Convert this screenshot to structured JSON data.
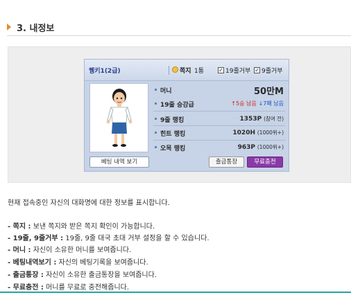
{
  "section": {
    "number_title": "3. 내정보"
  },
  "profile": {
    "nickname": "퀭키1(2급)",
    "note_label": "쪽지",
    "note_count": "1통",
    "check_19": "19줄거부",
    "check_9": "9줄거부",
    "checks_state": {
      "check_19": true,
      "check_9": true
    }
  },
  "stats": {
    "money": {
      "label": "머니",
      "value": "50만M"
    },
    "rank19": {
      "label": "19줄 승강급",
      "up": "↑5승 남음",
      "down": "↓7패 남음"
    },
    "rank9": {
      "label": "9줄 랭킹",
      "value": "1353P",
      "note": "(참여 전)"
    },
    "hint": {
      "label": "힌트 랭킹",
      "value": "1020H",
      "note": "(1000위+)"
    },
    "omok": {
      "label": "오목 랭킹",
      "value": "963P",
      "note": "(1000위+)"
    }
  },
  "buttons": {
    "bet_history": "베팅 내역 보기",
    "bank": "출금통장",
    "charge": "무료충전"
  },
  "description": {
    "intro": "현재 접속중인 자신의 대화명에 대한 정보를 표시합니다.",
    "items": [
      {
        "term": "- 쪽지 :",
        "text": " 보낸 쪽지와 받은 쪽지 확인이 가능합니다."
      },
      {
        "term": "- 19줄, 9줄거부 :",
        "text": " 19줄, 9줄 대국 초대 거부 설정을 할 수 있습니다."
      },
      {
        "term": "- 머니 :",
        "text": " 자신이 소유한 머니를 보여줍니다."
      },
      {
        "term": "- 베팅내역보기 :",
        "text": " 자신의 베팅기록을 보여줍니다."
      },
      {
        "term": "- 출금통장 :",
        "text": " 자신이 소유한 출금통장을 보여줍니다."
      },
      {
        "term": "- 무료충전 :",
        "text": " 머니를 무료로 충전해줍니다."
      }
    ]
  },
  "colors": {
    "accent": "#e58a2e",
    "card_bg": "#c7d3e6",
    "charge_btn": "#8a3aa6",
    "footer_line": "#27a59a"
  }
}
